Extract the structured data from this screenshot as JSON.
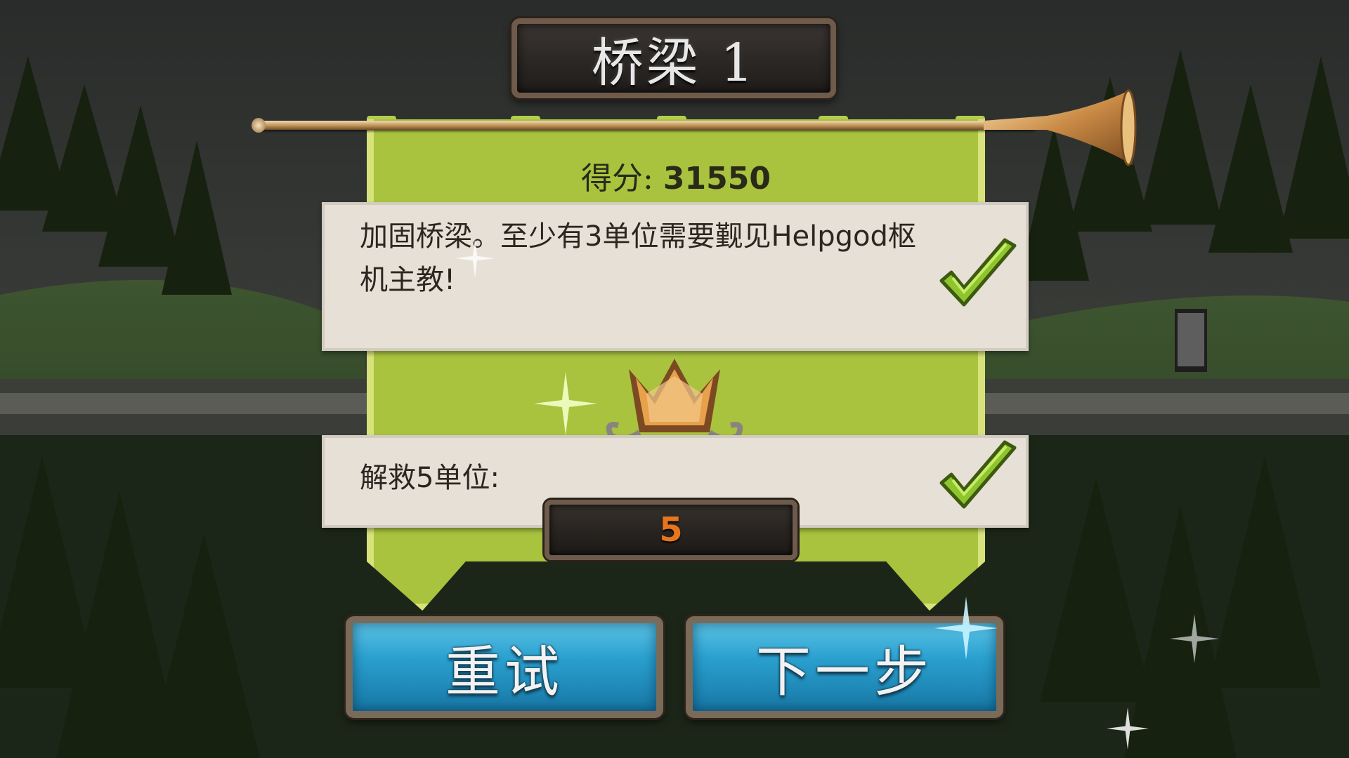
{
  "level": {
    "title": "桥梁 1"
  },
  "score": {
    "label": "得分:",
    "value": "31550"
  },
  "objectives": [
    {
      "text": "加固桥梁。至少有3单位需要觐见Helpgod枢机主教!",
      "completed": true,
      "icon": "checkmark-icon"
    },
    {
      "text": "解救5单位:",
      "completed": true,
      "icon": "checkmark-icon",
      "count": "5"
    }
  ],
  "buttons": {
    "retry_label": "重试",
    "next_label": "下一步"
  },
  "colors": {
    "banner": "#bcd35a",
    "button": "#2aa0cf",
    "count": "#e8751e",
    "check": "#8fc52c"
  }
}
